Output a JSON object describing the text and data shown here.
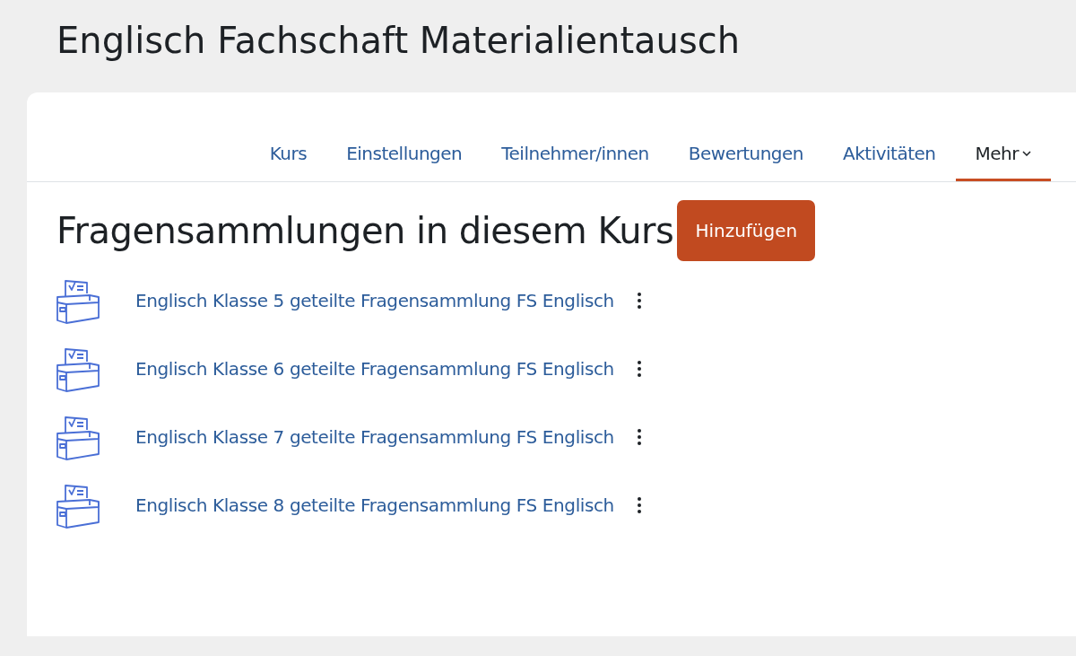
{
  "page_title": "Englisch Fachschaft Materialientausch",
  "tabs": [
    {
      "label": "Kurs",
      "selected": false,
      "dropdown": false
    },
    {
      "label": "Einstellungen",
      "selected": false,
      "dropdown": false
    },
    {
      "label": "Teilnehmer/innen",
      "selected": false,
      "dropdown": false
    },
    {
      "label": "Bewertungen",
      "selected": false,
      "dropdown": false
    },
    {
      "label": "Aktivitäten",
      "selected": false,
      "dropdown": false
    },
    {
      "label": "Mehr",
      "selected": true,
      "dropdown": true
    }
  ],
  "heading": "Fragensammlungen in diesem Kurs",
  "add_button": "Hinzufügen",
  "banks": [
    {
      "name": "Englisch Klasse 5 geteilte Fragensammlung FS Englisch"
    },
    {
      "name": "Englisch Klasse 6 geteilte Fragensammlung FS Englisch"
    },
    {
      "name": "Englisch Klasse 7 geteilte Fragensammlung FS Englisch"
    },
    {
      "name": "Englisch Klasse 8 geteilte Fragensammlung FS Englisch"
    }
  ]
}
